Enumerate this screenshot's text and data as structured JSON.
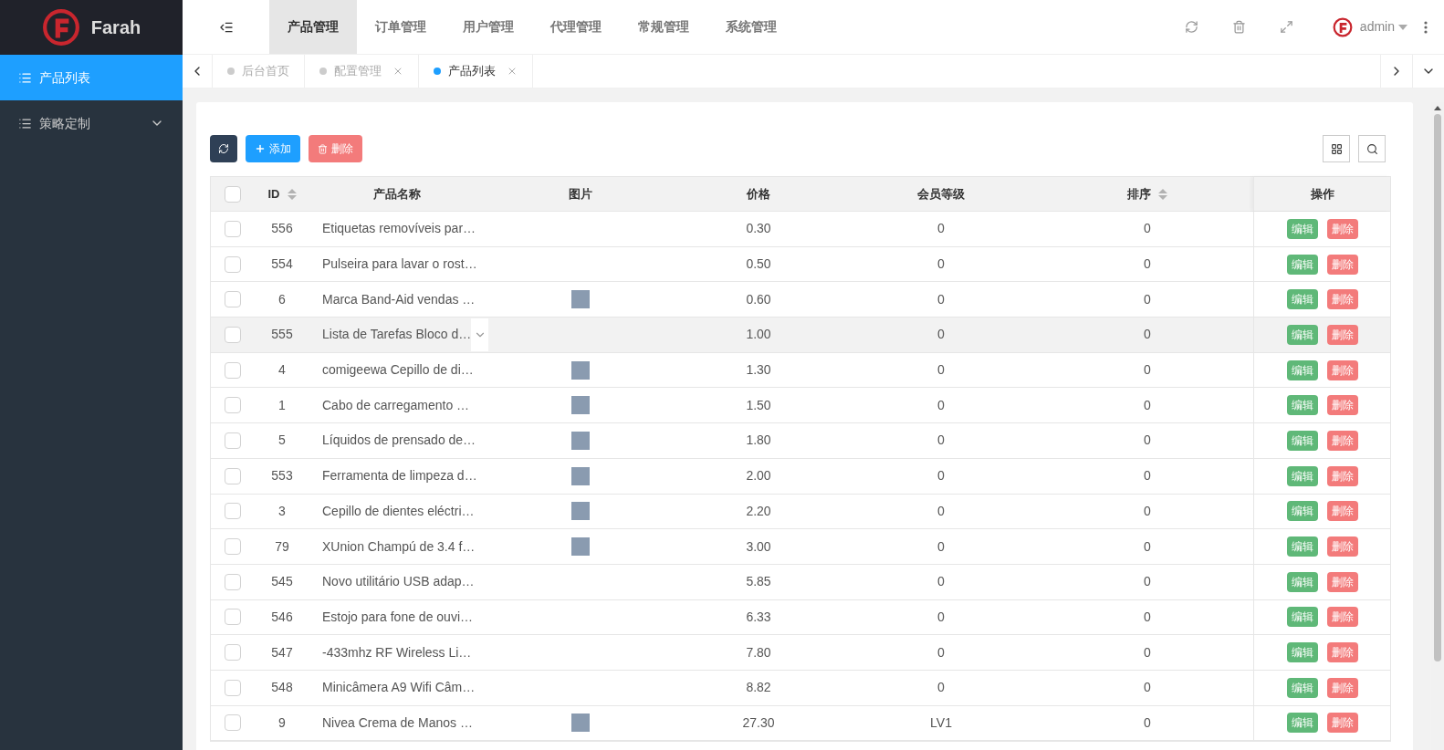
{
  "sidebar": {
    "brand": "Farah",
    "items": [
      {
        "label": "产品列表",
        "selected": true,
        "expandable": false
      },
      {
        "label": "策略定制",
        "selected": false,
        "expandable": true
      }
    ]
  },
  "top_nav": {
    "items": [
      {
        "label": "产品管理",
        "selected": true
      },
      {
        "label": "订单管理",
        "selected": false
      },
      {
        "label": "用户管理",
        "selected": false
      },
      {
        "label": "代理管理",
        "selected": false
      },
      {
        "label": "常规管理",
        "selected": false
      },
      {
        "label": "系统管理",
        "selected": false
      }
    ],
    "user": "admin"
  },
  "tabs": [
    {
      "label": "后台首页",
      "selected": false,
      "closable": false
    },
    {
      "label": "配置管理",
      "selected": false,
      "closable": true
    },
    {
      "label": "产品列表",
      "selected": true,
      "closable": true
    }
  ],
  "toolbar": {
    "add": "添加",
    "delete": "删除"
  },
  "table": {
    "columns": [
      "ID",
      "产品名称",
      "图片",
      "价格",
      "会员等级",
      "排序",
      "操作"
    ],
    "select_all": {
      "checked": false
    },
    "rows": [
      {
        "checked": false,
        "id": "556",
        "name": "Etiquetas removíveis par…",
        "image": false,
        "price": "0.30",
        "level": "0",
        "sort": "0",
        "highlighted": false,
        "edit": "编辑",
        "delete": "删除"
      },
      {
        "checked": false,
        "id": "554",
        "name": "Pulseira para lavar o rost…",
        "image": false,
        "price": "0.50",
        "level": "0",
        "sort": "0",
        "highlighted": false,
        "edit": "编辑",
        "delete": "删除"
      },
      {
        "checked": false,
        "id": "6",
        "name": "Marca Band-Aid vendas …",
        "image": true,
        "price": "0.60",
        "level": "0",
        "sort": "0",
        "highlighted": false,
        "edit": "编辑",
        "delete": "删除"
      },
      {
        "checked": false,
        "id": "555",
        "name": "Lista de Tarefas Bloco d…",
        "image": false,
        "price": "1.00",
        "level": "0",
        "sort": "0",
        "highlighted": true,
        "edit": "编辑",
        "delete": "删除"
      },
      {
        "checked": false,
        "id": "4",
        "name": "comigeewa Cepillo de di…",
        "image": true,
        "price": "1.30",
        "level": "0",
        "sort": "0",
        "highlighted": false,
        "edit": "编辑",
        "delete": "删除"
      },
      {
        "checked": false,
        "id": "1",
        "name": "Cabo de carregamento …",
        "image": true,
        "price": "1.50",
        "level": "0",
        "sort": "0",
        "highlighted": false,
        "edit": "编辑",
        "delete": "删除"
      },
      {
        "checked": false,
        "id": "5",
        "name": "Líquidos de prensado de…",
        "image": true,
        "price": "1.80",
        "level": "0",
        "sort": "0",
        "highlighted": false,
        "edit": "编辑",
        "delete": "删除"
      },
      {
        "checked": false,
        "id": "553",
        "name": "Ferramenta de limpeza d…",
        "image": true,
        "price": "2.00",
        "level": "0",
        "sort": "0",
        "highlighted": false,
        "edit": "编辑",
        "delete": "删除"
      },
      {
        "checked": false,
        "id": "3",
        "name": "Cepillo de dientes eléctri…",
        "image": true,
        "price": "2.20",
        "level": "0",
        "sort": "0",
        "highlighted": false,
        "edit": "编辑",
        "delete": "删除"
      },
      {
        "checked": false,
        "id": "79",
        "name": "XUnion Champú de 3.4 f…",
        "image": true,
        "price": "3.00",
        "level": "0",
        "sort": "0",
        "highlighted": false,
        "edit": "编辑",
        "delete": "删除"
      },
      {
        "checked": false,
        "id": "545",
        "name": "Novo utilitário USB adap…",
        "image": false,
        "price": "5.85",
        "level": "0",
        "sort": "0",
        "highlighted": false,
        "edit": "编辑",
        "delete": "删除"
      },
      {
        "checked": false,
        "id": "546",
        "name": "Estojo para fone de ouvi…",
        "image": false,
        "price": "6.33",
        "level": "0",
        "sort": "0",
        "highlighted": false,
        "edit": "编辑",
        "delete": "删除"
      },
      {
        "checked": false,
        "id": "547",
        "name": "-433mhz RF Wireless Li…",
        "image": false,
        "price": "7.80",
        "level": "0",
        "sort": "0",
        "highlighted": false,
        "edit": "编辑",
        "delete": "删除"
      },
      {
        "checked": false,
        "id": "548",
        "name": "Minicâmera A9 Wifi Câm…",
        "image": false,
        "price": "8.82",
        "level": "0",
        "sort": "0",
        "highlighted": false,
        "edit": "编辑",
        "delete": "删除"
      },
      {
        "checked": false,
        "id": "9",
        "name": "Nivea Crema de Manos …",
        "image": true,
        "price": "27.30",
        "level": "LV1",
        "sort": "0",
        "highlighted": false,
        "edit": "编辑",
        "delete": "删除"
      }
    ]
  }
}
